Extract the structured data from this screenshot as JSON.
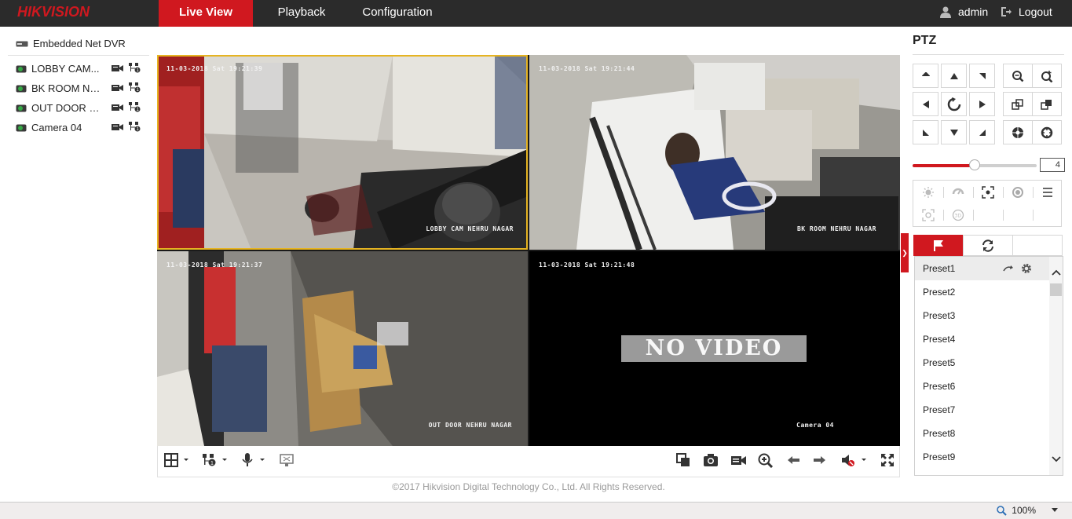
{
  "brand": "HIKVISION",
  "nav": {
    "tabs": [
      {
        "label": "Live View",
        "active": true
      },
      {
        "label": "Playback",
        "active": false
      },
      {
        "label": "Configuration",
        "active": false
      }
    ],
    "user": "admin",
    "logout": "Logout"
  },
  "tree": {
    "root": "Embedded Net DVR",
    "cameras": [
      {
        "name": "LOBBY CAM..."
      },
      {
        "name": "BK ROOM NE..."
      },
      {
        "name": "OUT DOOR N..."
      },
      {
        "name": "Camera 04"
      }
    ]
  },
  "video": {
    "cells": [
      {
        "timestamp": "11-03-2018 Sat 19:21:39",
        "label": "LOBBY CAM NEHRU NAGAR",
        "selected": true
      },
      {
        "timestamp": "11-03-2018 Sat 19:21:44",
        "label": "BK ROOM NEHRU NAGAR",
        "selected": false
      },
      {
        "timestamp": "11-03-2018 Sat 19:21:37",
        "label": "OUT DOOR NEHRU NAGAR",
        "selected": false
      },
      {
        "timestamp": "11-03-2018 Sat 19:21:48",
        "label": "Camera 04",
        "no_video": "NO VIDEO",
        "selected": false
      }
    ]
  },
  "toolbar": {
    "left_icons": [
      "layout-icon",
      "stream-icon",
      "microphone-icon",
      "digital-zoom-icon"
    ],
    "right_icons": [
      "stop-all-icon",
      "capture-icon",
      "record-icon",
      "zoom-icon",
      "prev-page-icon",
      "next-page-icon",
      "audio-icon",
      "fullscreen-icon"
    ]
  },
  "copyright": "©2017 Hikvision Digital Technology Co., Ltd. All Rights Reserved.",
  "ptz": {
    "title": "PTZ",
    "speed": "4",
    "speed_fraction": 0.5,
    "presets": [
      "Preset1",
      "Preset2",
      "Preset3",
      "Preset4",
      "Preset5",
      "Preset6",
      "Preset7",
      "Preset8",
      "Preset9"
    ]
  },
  "status": {
    "zoom": "100%"
  },
  "colors": {
    "accent": "#d0181f",
    "topbar": "#2b2b2b",
    "selected_cell": "#e6b422"
  }
}
